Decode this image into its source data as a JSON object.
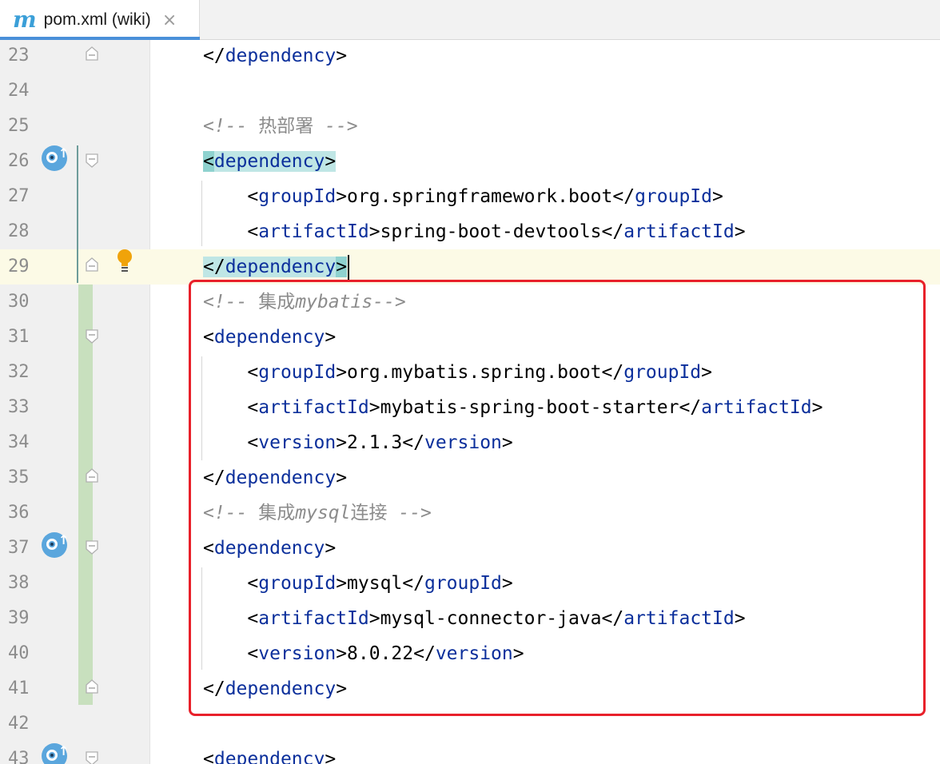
{
  "tab": {
    "icon": "m",
    "title": "pom.xml (wiki)",
    "close": "×"
  },
  "lines": [
    {
      "no": "23",
      "code": [
        {
          "t": "</",
          "c": ""
        },
        {
          "t": "dependency",
          "c": "tag"
        },
        {
          "t": ">",
          "c": ""
        }
      ]
    },
    {
      "no": "24",
      "code": []
    },
    {
      "no": "25",
      "code": [
        {
          "t": "<!-- ",
          "c": "cmt"
        },
        {
          "t": "热部署",
          "c": "cmt-han"
        },
        {
          "t": " -->",
          "c": "cmt"
        }
      ]
    },
    {
      "no": "26",
      "code": [
        {
          "t": "<",
          "c": "hl-dark"
        },
        {
          "t": "dependency",
          "c": "tag hl"
        },
        {
          "t": ">",
          "c": "hl"
        }
      ]
    },
    {
      "no": "27",
      "code": [
        {
          "t": "    <",
          "c": ""
        },
        {
          "t": "groupId",
          "c": "tag"
        },
        {
          "t": ">org.springframework.boot</",
          "c": ""
        },
        {
          "t": "groupId",
          "c": "tag"
        },
        {
          "t": ">",
          "c": ""
        }
      ]
    },
    {
      "no": "28",
      "code": [
        {
          "t": "    <",
          "c": ""
        },
        {
          "t": "artifactId",
          "c": "tag"
        },
        {
          "t": ">spring-boot-devtools</",
          "c": ""
        },
        {
          "t": "artifactId",
          "c": "tag"
        },
        {
          "t": ">",
          "c": ""
        }
      ]
    },
    {
      "no": "29",
      "code": [
        {
          "t": "</",
          "c": "hl"
        },
        {
          "t": "dependency",
          "c": "tag hl"
        },
        {
          "t": ">",
          "c": "hl-dark"
        }
      ]
    },
    {
      "no": "30",
      "code": [
        {
          "t": "<!-- ",
          "c": "cmt"
        },
        {
          "t": "集成",
          "c": "cmt-han"
        },
        {
          "t": "mybatis-->",
          "c": "cmt"
        }
      ]
    },
    {
      "no": "31",
      "code": [
        {
          "t": "<",
          "c": ""
        },
        {
          "t": "dependency",
          "c": "tag"
        },
        {
          "t": ">",
          "c": ""
        }
      ]
    },
    {
      "no": "32",
      "code": [
        {
          "t": "    <",
          "c": ""
        },
        {
          "t": "groupId",
          "c": "tag"
        },
        {
          "t": ">org.mybatis.spring.boot</",
          "c": ""
        },
        {
          "t": "groupId",
          "c": "tag"
        },
        {
          "t": ">",
          "c": ""
        }
      ]
    },
    {
      "no": "33",
      "code": [
        {
          "t": "    <",
          "c": ""
        },
        {
          "t": "artifactId",
          "c": "tag"
        },
        {
          "t": ">mybatis-spring-boot-starter</",
          "c": ""
        },
        {
          "t": "artifactId",
          "c": "tag"
        },
        {
          "t": ">",
          "c": ""
        }
      ]
    },
    {
      "no": "34",
      "code": [
        {
          "t": "    <",
          "c": ""
        },
        {
          "t": "version",
          "c": "tag"
        },
        {
          "t": ">2.1.3</",
          "c": ""
        },
        {
          "t": "version",
          "c": "tag"
        },
        {
          "t": ">",
          "c": ""
        }
      ]
    },
    {
      "no": "35",
      "code": [
        {
          "t": "</",
          "c": ""
        },
        {
          "t": "dependency",
          "c": "tag"
        },
        {
          "t": ">",
          "c": ""
        }
      ]
    },
    {
      "no": "36",
      "code": [
        {
          "t": "<!-- ",
          "c": "cmt"
        },
        {
          "t": "集成",
          "c": "cmt-han"
        },
        {
          "t": "mysql",
          "c": "cmt"
        },
        {
          "t": "连接",
          "c": "cmt-han"
        },
        {
          "t": " -->",
          "c": "cmt"
        }
      ]
    },
    {
      "no": "37",
      "code": [
        {
          "t": "<",
          "c": ""
        },
        {
          "t": "dependency",
          "c": "tag"
        },
        {
          "t": ">",
          "c": ""
        }
      ]
    },
    {
      "no": "38",
      "code": [
        {
          "t": "    <",
          "c": ""
        },
        {
          "t": "groupId",
          "c": "tag"
        },
        {
          "t": ">mysql</",
          "c": ""
        },
        {
          "t": "groupId",
          "c": "tag"
        },
        {
          "t": ">",
          "c": ""
        }
      ]
    },
    {
      "no": "39",
      "code": [
        {
          "t": "    <",
          "c": ""
        },
        {
          "t": "artifactId",
          "c": "tag"
        },
        {
          "t": ">mysql-connector-java</",
          "c": ""
        },
        {
          "t": "artifactId",
          "c": "tag"
        },
        {
          "t": ">",
          "c": ""
        }
      ]
    },
    {
      "no": "40",
      "code": [
        {
          "t": "    <",
          "c": ""
        },
        {
          "t": "version",
          "c": "tag"
        },
        {
          "t": ">8.0.22</",
          "c": ""
        },
        {
          "t": "version",
          "c": "tag"
        },
        {
          "t": ">",
          "c": ""
        }
      ]
    },
    {
      "no": "41",
      "code": [
        {
          "t": "</",
          "c": ""
        },
        {
          "t": "dependency",
          "c": "tag"
        },
        {
          "t": ">",
          "c": ""
        }
      ]
    },
    {
      "no": "42",
      "code": []
    },
    {
      "no": "43",
      "code": [
        {
          "t": "<",
          "c": ""
        },
        {
          "t": "dependency",
          "c": "tag"
        },
        {
          "t": ">",
          "c": ""
        }
      ]
    }
  ],
  "gutter_icons": {
    "implementation_icon": "gutter-implemented-icon",
    "intention_icon": "lightbulb-icon",
    "fold_icon": "fold-marker-icon"
  },
  "colors": {
    "tag": "#0b2f9b",
    "comment": "#8c8c8c",
    "annotation_box": "#e8202a",
    "brace_match": "#bfe6e5",
    "current_line": "#fcfae6",
    "vcs_added": "#c8e0be"
  }
}
